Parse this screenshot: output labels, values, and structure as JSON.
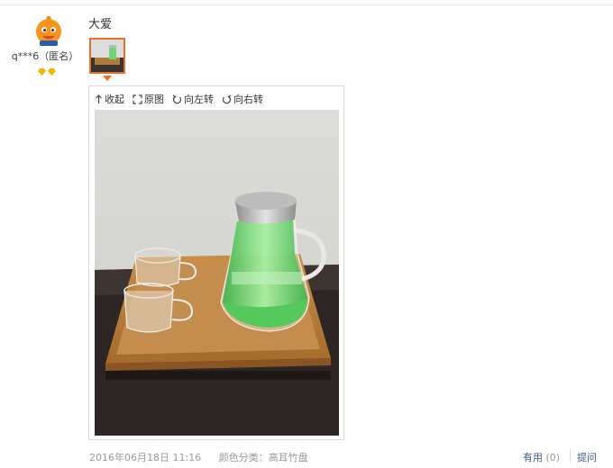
{
  "user": {
    "name": "q***6（匿名）",
    "avatar_icon": "orange-mascot-avatar",
    "badge_icon": "diamond-icon",
    "badge_count": 2,
    "badge_color": "#f5b400"
  },
  "review": {
    "text": "大爱",
    "thumbnail_icon": "photo-thumbnail",
    "accent_color": "#e5702b"
  },
  "viewer": {
    "toolbar": {
      "collapse_label": "收起",
      "original_label": "原图",
      "rotate_left_label": "向左转",
      "rotate_right_label": "向右转"
    }
  },
  "footer": {
    "date": "2016年06月18日 11:16",
    "variant": "颜色分类：高耳竹盘",
    "helpful_label": "有用",
    "helpful_count": "(0)",
    "ask_label": "提问",
    "link_color": "#3c5b99"
  }
}
